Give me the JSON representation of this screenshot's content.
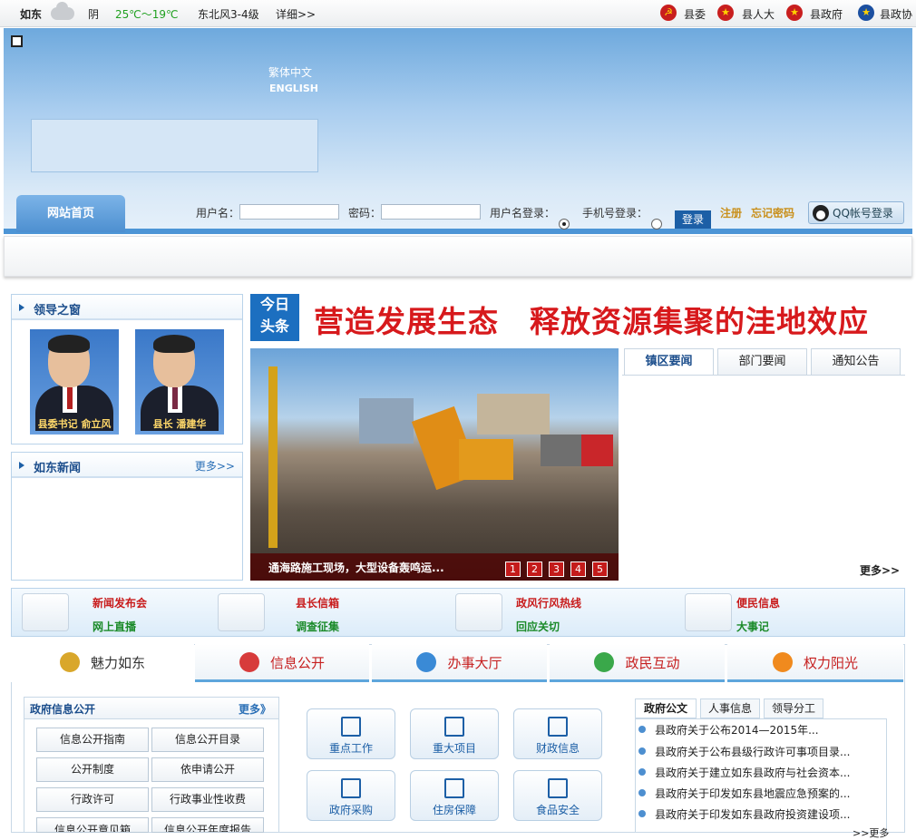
{
  "topbar": {
    "city": "如东",
    "weather": "阴",
    "temp": "25℃～19℃",
    "wind": "东北风3-4级",
    "detail_link": "详细>>",
    "links": [
      "县委",
      "县人大",
      "县政府",
      "县政协"
    ],
    "colors": {
      "temp": "#20a020"
    }
  },
  "banner": {
    "lang_traditional": "繁体中文",
    "lang_english": "ENGLISH"
  },
  "nav": {
    "home_tab": "网站首页",
    "username_label": "用户名：",
    "username_value": "",
    "password_label": "密码：",
    "password_value": "",
    "login_mode_user": "用户名登录：",
    "login_mode_phone": "手机号登录：",
    "login_mode_selected": "用户名登录",
    "login_button": "登录",
    "register_link": "注册",
    "forgot_link": "忘记密码",
    "qq_login": "QQ帐号登录"
  },
  "leaders": {
    "title": "领导之窗",
    "people": [
      {
        "caption": "县委书记 俞立风"
      },
      {
        "caption": "县长 潘建华"
      }
    ]
  },
  "news": {
    "title": "如东新闻",
    "more": "更多>>"
  },
  "headline": {
    "badge_top": "今日",
    "badge_bottom": "头条",
    "text": "营造发展生态　释放资源集聚的洼地效应"
  },
  "slideshow": {
    "caption": "通海路施工现场，大型设备轰鸣运...",
    "pages": [
      "1",
      "2",
      "3",
      "4",
      "5"
    ],
    "active_page": "1"
  },
  "news_tabs": {
    "tabs": [
      "镇区要闻",
      "部门要闻",
      "通知公告"
    ],
    "active": "镇区要闻",
    "more": "更多>>"
  },
  "quick_links": [
    {
      "icon": "press-conference-icon",
      "red": "新闻发布会",
      "green": "网上直播"
    },
    {
      "icon": "mailbox-icon",
      "red": "县长信箱",
      "green": "调查征集"
    },
    {
      "icon": "hotline-icon",
      "red": "政风行风热线",
      "green": "回应关切"
    },
    {
      "icon": "computer-icon",
      "red": "便民信息",
      "green": "大事记"
    }
  ],
  "main_tabs": {
    "items": [
      {
        "label": "魅力如东",
        "icon": "charm-icon",
        "color": "#d9a72b"
      },
      {
        "label": "信息公开",
        "icon": "info-icon",
        "color": "#d73b3b"
      },
      {
        "label": "办事大厅",
        "icon": "hall-icon",
        "color": "#3a8ad6"
      },
      {
        "label": "政民互动",
        "icon": "interaction-icon",
        "color": "#3aa84a"
      },
      {
        "label": "权力阳光",
        "icon": "sun-icon",
        "color": "#f08a1e"
      }
    ],
    "active": "魅力如东"
  },
  "gov_info": {
    "title": "政府信息公开",
    "more": "更多》",
    "buttons": [
      "信息公开指南",
      "信息公开目录",
      "公开制度",
      "依申请公开",
      "行政许可",
      "行政事业性收费",
      "信息公开意见箱",
      "信息公开年度报告"
    ]
  },
  "services": [
    "重点工作",
    "重大项目",
    "财政信息",
    "政府采购",
    "住房保障",
    "食品安全"
  ],
  "docs": {
    "tabs": [
      "政府公文",
      "人事信息",
      "领导分工"
    ],
    "active": "政府公文",
    "items": [
      "县政府关于公布2014—2015年...",
      "县政府关于公布县级行政许可事项目录...",
      "县政府关于建立如东县政府与社会资本...",
      "县政府关于印发如东县地震应急预案的...",
      "县政府关于印发如东县政府投资建设项..."
    ],
    "more": ">>更多"
  }
}
